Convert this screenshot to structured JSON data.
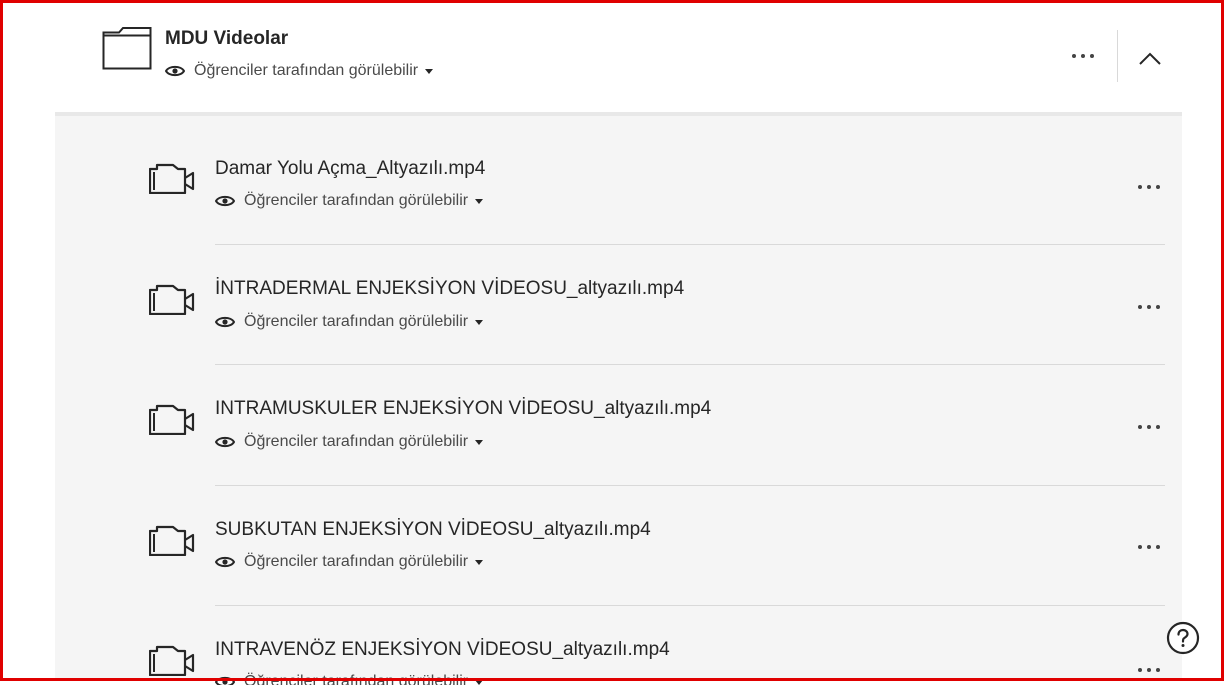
{
  "folder": {
    "title": "MDU Videolar",
    "visibility": "Öğrenciler tarafından görülebilir"
  },
  "items": [
    {
      "title": "Damar Yolu Açma_Altyazılı.mp4",
      "visibility": "Öğrenciler tarafından görülebilir"
    },
    {
      "title": "İNTRADERMAL ENJEKSİYON VİDEOSU_altyazılı.mp4",
      "visibility": "Öğrenciler tarafından görülebilir"
    },
    {
      "title": "INTRAMUSKULER ENJEKSİYON VİDEOSU_altyazılı.mp4",
      "visibility": "Öğrenciler tarafından görülebilir"
    },
    {
      "title": "SUBKUTAN ENJEKSİYON VİDEOSU_altyazılı.mp4",
      "visibility": "Öğrenciler tarafından görülebilir"
    },
    {
      "title": "INTRAVENÖZ ENJEKSİYON VİDEOSU_altyazılı.mp4",
      "visibility": "Öğrenciler tarafından görülebilir"
    }
  ],
  "icons": {
    "folder": "folder-icon",
    "video": "video-camera-icon",
    "visibility": "eye-icon",
    "more": "more-options-icon",
    "collapse": "chevron-up-icon",
    "help": "help-icon"
  },
  "colors": {
    "frame_border": "#e00000",
    "panel_background": "#f5f5f5",
    "text": "#262626"
  }
}
